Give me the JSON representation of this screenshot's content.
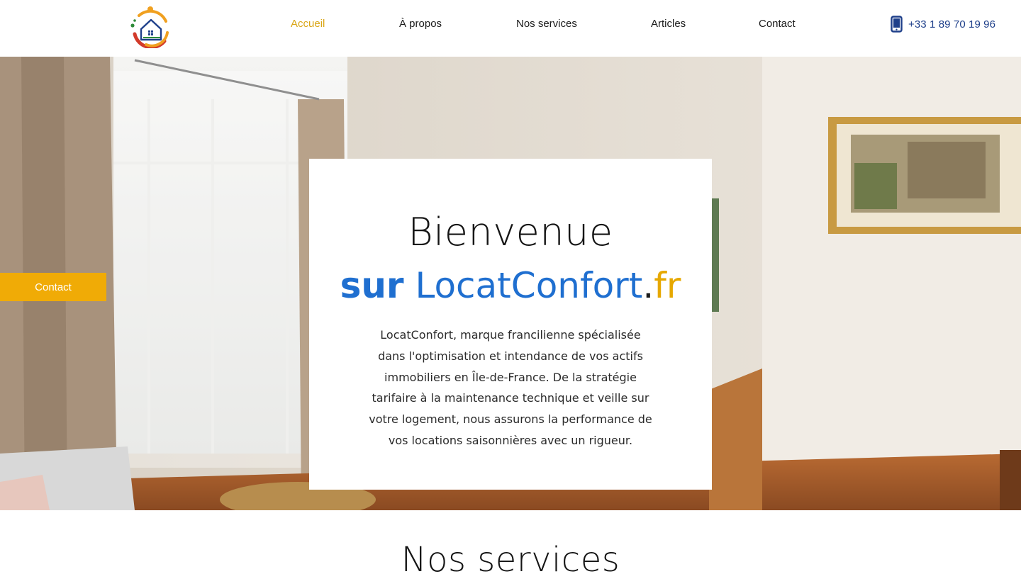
{
  "header": {
    "logo_name": "locatconfort-logo",
    "nav": [
      {
        "label": "Accueil",
        "active": true
      },
      {
        "label": "À propos",
        "active": false
      },
      {
        "label": "Nos services",
        "active": false
      },
      {
        "label": "Articles",
        "active": false
      },
      {
        "label": "Contact",
        "active": false
      }
    ],
    "phone": {
      "icon": "phone-icon",
      "number": "+33 1 89 70 19 96"
    }
  },
  "hero": {
    "contact_tab": "Contact",
    "title": "Bienvenue",
    "subtitle": {
      "sur": "sur",
      "brand": "LocatConfort",
      "dot": ".",
      "tld": "fr"
    },
    "body": "LocatConfort, marque francilienne spécialisée dans l'optimisation et intendance de vos actifs immobiliers en Île-de-France. De la stratégie tarifaire à la maintenance technique et veille sur votre logement, nous assurons la performance de vos locations saisonnières avec un rigueur."
  },
  "services": {
    "title": "Nos services"
  },
  "colors": {
    "accent": "#d9a514",
    "contact_tab": "#f0ab06",
    "brand_blue": "#1f6fd0",
    "phone_blue": "#1e3f8a"
  }
}
